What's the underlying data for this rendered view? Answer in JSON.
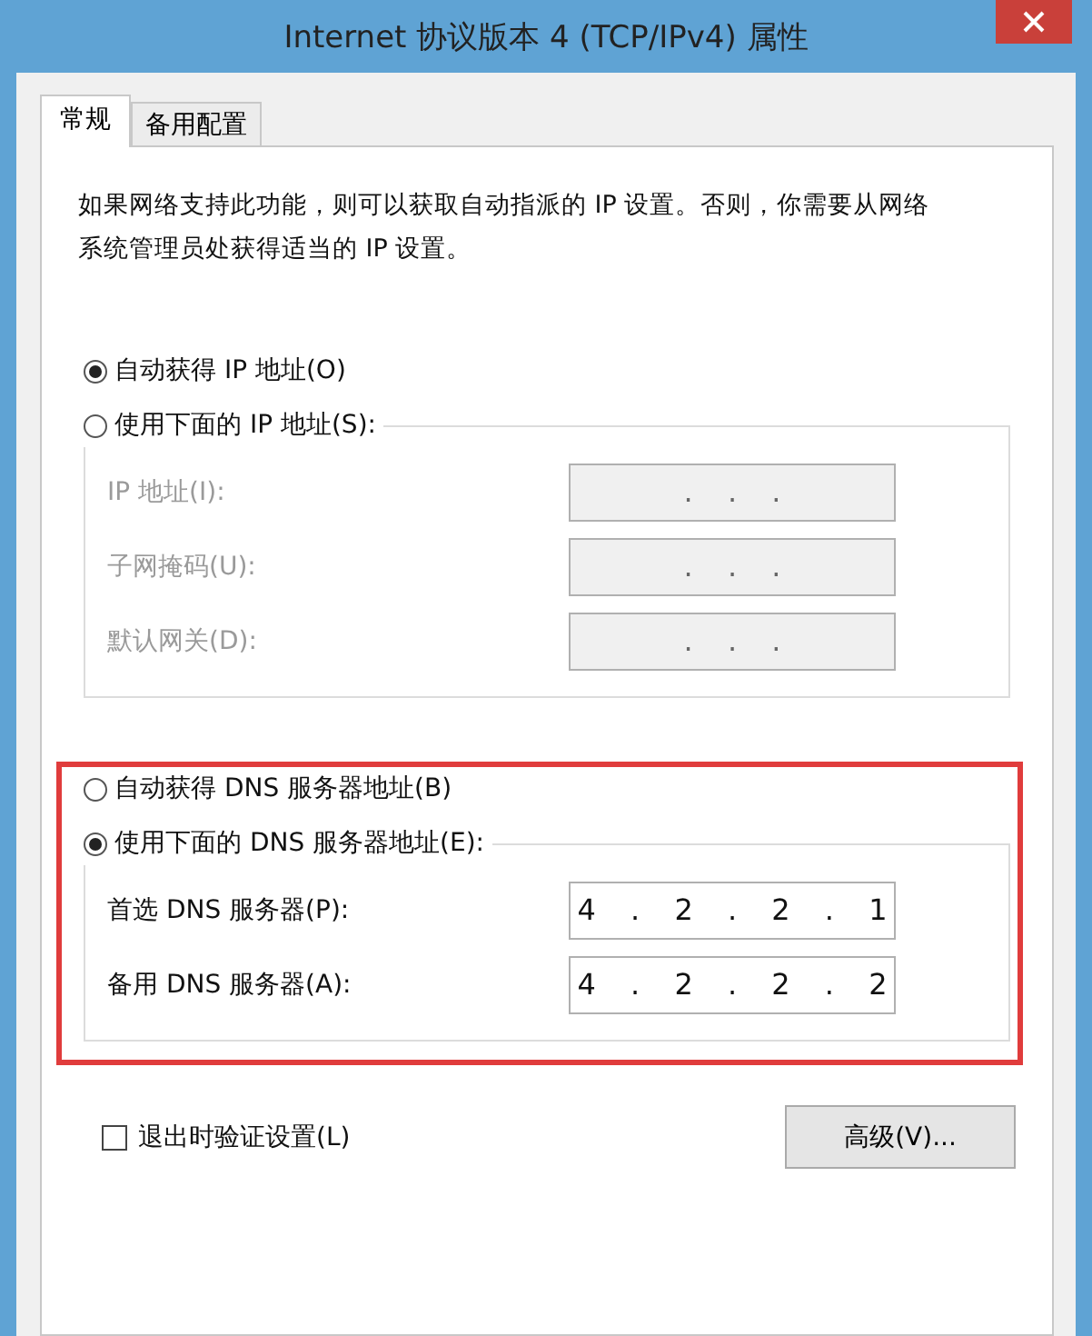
{
  "window": {
    "title": "Internet 协议版本 4 (TCP/IPv4) 属性"
  },
  "tabs": [
    {
      "label": "常规",
      "selected": true
    },
    {
      "label": "备用配置",
      "selected": false
    }
  ],
  "description": "如果网络支持此功能，则可以获取自动指派的 IP 设置。否则，你需要从网络系统管理员处获得适当的 IP 设置。",
  "ip_section": {
    "auto_option": {
      "label": "自动获得 IP 地址(O)",
      "selected": true
    },
    "manual_option": {
      "label": "使用下面的 IP 地址(S):",
      "selected": false
    },
    "fields": [
      {
        "label": "IP 地址(I):",
        "value": ". . .",
        "disabled": true
      },
      {
        "label": "子网掩码(U):",
        "value": ". . .",
        "disabled": true
      },
      {
        "label": "默认网关(D):",
        "value": ". . .",
        "disabled": true
      }
    ]
  },
  "dns_section": {
    "highlighted": true,
    "auto_option": {
      "label": "自动获得 DNS 服务器地址(B)",
      "selected": false
    },
    "manual_option": {
      "label": "使用下面的 DNS 服务器地址(E):",
      "selected": true
    },
    "fields": [
      {
        "label": "首选 DNS 服务器(P):",
        "value": "4 . 2 . 2 . 1",
        "disabled": false
      },
      {
        "label": "备用 DNS 服务器(A):",
        "value": "4 . 2 . 2 . 2",
        "disabled": false
      }
    ]
  },
  "validate_checkbox": {
    "label": "退出时验证设置(L)",
    "checked": false
  },
  "advanced_button": {
    "label": "高级(V)..."
  }
}
